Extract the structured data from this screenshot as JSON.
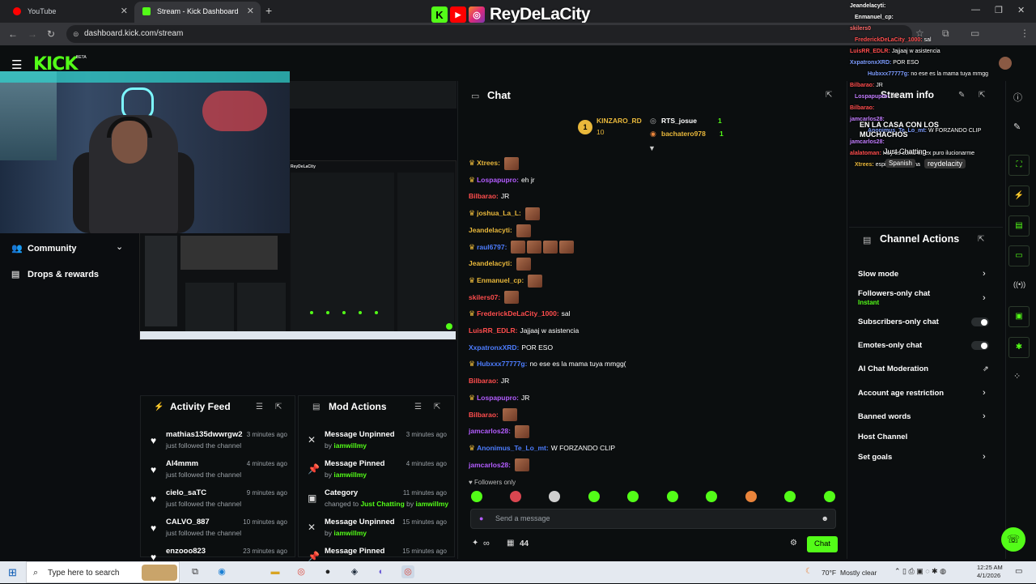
{
  "browser": {
    "tabs": [
      {
        "title": "YouTube",
        "active": false
      },
      {
        "title": "Stream - Kick Dashboard",
        "active": true
      }
    ],
    "url": "dashboard.kick.com/stream"
  },
  "overlay": {
    "streamer_name": "ReyDeLaCity",
    "chat_lines": [
      {
        "user": "Jeandelacyti:",
        "text": ""
      },
      {
        "user": "Enmanuel_cp:",
        "text": ""
      },
      {
        "user": "skilers0",
        "text": ""
      },
      {
        "user": "FrederickDeLaCity_1000:",
        "text": "sal"
      },
      {
        "user": "LuisRR_EDLR:",
        "text": "Jajjaaj w asistencia"
      },
      {
        "user": "XxpatronxXRD:",
        "text": "POR ESO"
      },
      {
        "user": "Hubxxx77777g:",
        "text": "no ese es la mama tuya mmgg"
      },
      {
        "user": "Bilbarao:",
        "text": "JR"
      },
      {
        "user": "Lospapupro:",
        "text": "JR"
      },
      {
        "user": "Bilbarao:",
        "text": ""
      },
      {
        "user": "jamcarlos28:",
        "text": ""
      },
      {
        "user": "Anonimus_Te_Lo_mt:",
        "text": "W FORZANDO CLIP"
      },
      {
        "user": "jamcarlos28:",
        "text": ""
      },
      {
        "user": "alalatoman:",
        "text": "Hoy es como mi ex puro ilucionarme"
      },
      {
        "user": "Xtrees:",
        "text": "espiritu de la oma"
      }
    ],
    "stream_title": "EN LA CASA CON LOS MUCHACHOS",
    "category": "Just Chatting",
    "language": "Spanish",
    "channel": "reydelacity"
  },
  "nav": {
    "logo": "KICK",
    "beta": "BETA",
    "items": [
      {
        "label": "Community"
      },
      {
        "label": "Drops & rewards"
      }
    ]
  },
  "preview": {
    "title": "ReyDeLaCity"
  },
  "activity_feed": {
    "title": "Activity Feed",
    "items": [
      {
        "name": "mathias135dwwrgw2",
        "sub": "just followed the channel",
        "time": "3 minutes ago"
      },
      {
        "name": "Al4mmm",
        "sub": "just followed the channel",
        "time": "4 minutes ago"
      },
      {
        "name": "cielo_saTC",
        "sub": "just followed the channel",
        "time": "9 minutes ago"
      },
      {
        "name": "CALVO_887",
        "sub": "just followed the channel",
        "time": "10 minutes ago"
      },
      {
        "name": "enzooo823",
        "sub": "",
        "time": "23 minutes ago"
      }
    ]
  },
  "mod_actions": {
    "title": "Mod Actions",
    "items": [
      {
        "name": "Message Unpinned",
        "pre": "by",
        "actor": "iamwillmy",
        "mid": "",
        "target": "",
        "time": "3 minutes ago",
        "icon": "unpin"
      },
      {
        "name": "Message Pinned",
        "pre": "by",
        "actor": "iamwillmy",
        "mid": "",
        "target": "",
        "time": "4 minutes ago",
        "icon": "pin"
      },
      {
        "name": "Category",
        "pre": "changed to",
        "actor": "Just Chatting",
        "mid": "by",
        "target": "iamwillmy",
        "time": "11 minutes ago",
        "icon": "category"
      },
      {
        "name": "Message Unpinned",
        "pre": "by",
        "actor": "iamwillmy",
        "mid": "",
        "target": "",
        "time": "15 minutes ago",
        "icon": "unpin"
      },
      {
        "name": "Message Pinned",
        "pre": "",
        "actor": "",
        "mid": "",
        "target": "",
        "time": "15 minutes ago",
        "icon": "pin"
      }
    ]
  },
  "chat": {
    "title": "Chat",
    "gifters": [
      {
        "name": "KINZARO_RD",
        "count": "10",
        "rank": "1"
      },
      {
        "name": "RTS_josue",
        "count": "1"
      },
      {
        "name": "bachatero978",
        "count": "1"
      }
    ],
    "messages": [
      {
        "user": "Xtrees:",
        "color": "#e9b83b",
        "text": "",
        "emotes": 1,
        "crown": true
      },
      {
        "user": "Lospapupro:",
        "color": "#b35cff",
        "text": "eh jr",
        "emotes": 0,
        "crown": true
      },
      {
        "user": "Bilbarao:",
        "color": "#ff4d4d",
        "text": "JR",
        "emotes": 0,
        "crown": false
      },
      {
        "user": "joshua_La_L:",
        "color": "#e9b83b",
        "text": "",
        "emotes": 1,
        "crown": true
      },
      {
        "user": "Jeandelacyti:",
        "color": "#e9b83b",
        "text": "",
        "emotes": 1,
        "crown": false
      },
      {
        "user": "raul6797:",
        "color": "#4d7dff",
        "text": "",
        "emotes": 4,
        "crown": true
      },
      {
        "user": "Jeandelacyti:",
        "color": "#e9b83b",
        "text": "",
        "emotes": 1,
        "crown": false
      },
      {
        "user": "Enmanuel_cp:",
        "color": "#e9b83b",
        "text": "",
        "emotes": 1,
        "crown": true
      },
      {
        "user": "skilers07:",
        "color": "#ff4d4d",
        "text": "",
        "emotes": 1,
        "crown": false
      },
      {
        "user": "FrederickDeLaCity_1000:",
        "color": "#ff4d4d",
        "text": "sal",
        "emotes": 0,
        "crown": true
      },
      {
        "user": "LuisRR_EDLR:",
        "color": "#ff4d4d",
        "text": "Jajjaaj w asistencia",
        "emotes": 0,
        "crown": false
      },
      {
        "user": "XxpatronxXRD:",
        "color": "#4d7dff",
        "text": "POR ESO",
        "emotes": 0,
        "crown": false
      },
      {
        "user": "Hubxxx77777g:",
        "color": "#4d7dff",
        "text": "no ese es la mama tuya mmgg(",
        "emotes": 0,
        "crown": true
      },
      {
        "user": "Bilbarao:",
        "color": "#ff4d4d",
        "text": "JR",
        "emotes": 0,
        "crown": false
      },
      {
        "user": "Lospapupro:",
        "color": "#b35cff",
        "text": "JR",
        "emotes": 0,
        "crown": true
      },
      {
        "user": "Bilbarao:",
        "color": "#ff4d4d",
        "text": "",
        "emotes": 1,
        "crown": false
      },
      {
        "user": "jamcarlos28:",
        "color": "#b35cff",
        "text": "",
        "emotes": 1,
        "crown": false
      },
      {
        "user": "Anonimus_Te_Lo_mt:",
        "color": "#4d7dff",
        "text": "W FORZANDO CLIP",
        "emotes": 0,
        "crown": true
      },
      {
        "user": "jamcarlos28:",
        "color": "#b35cff",
        "text": "",
        "emotes": 1,
        "crown": false
      }
    ],
    "followers_only": "Followers only",
    "input_placeholder": "Send a message",
    "points": "∞",
    "viewers": "44",
    "send_label": "Chat"
  },
  "stream_info": {
    "title": "Stream info"
  },
  "channel_actions": {
    "title": "Channel Actions",
    "items": [
      {
        "label": "Slow mode",
        "control": "chevron"
      },
      {
        "label": "Followers-only chat",
        "sub": "Instant",
        "control": "chevron"
      },
      {
        "label": "Subscribers-only chat",
        "control": "toggle"
      },
      {
        "label": "Emotes-only chat",
        "control": "toggle"
      },
      {
        "label": "AI Chat Moderation",
        "control": "external"
      },
      {
        "label": "Account age restriction",
        "control": "chevron"
      },
      {
        "label": "Banned words",
        "control": "chevron"
      },
      {
        "label": "Host Channel",
        "control": "none"
      },
      {
        "label": "Set goals",
        "control": "chevron"
      }
    ]
  },
  "taskbar": {
    "search_placeholder": "Type here to search",
    "weather_temp": "70°F",
    "weather_desc": "Mostly clear",
    "time": "12:25 AM",
    "date": "4/1/2026"
  },
  "colors": {
    "kick_green": "#53fc18",
    "bg": "#0b0e0f"
  }
}
